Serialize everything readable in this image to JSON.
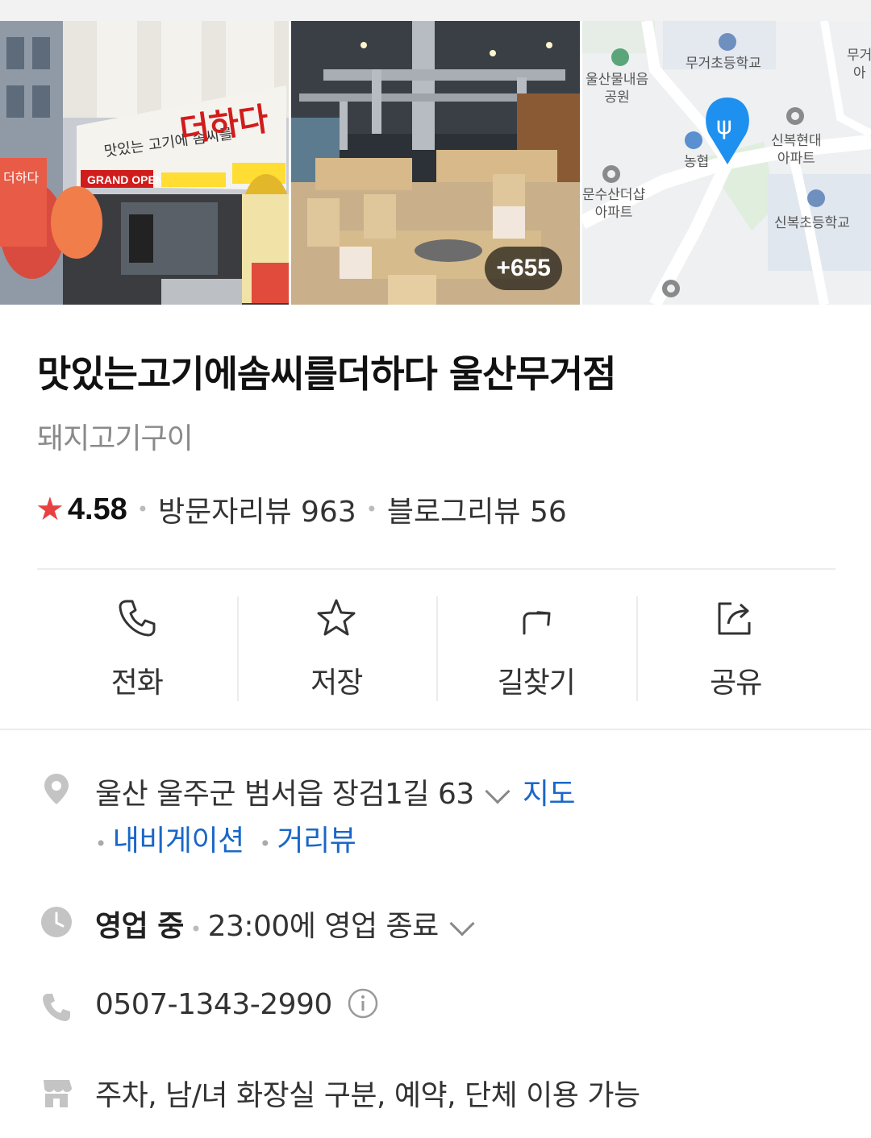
{
  "photos": {
    "more_count": "+655",
    "map_labels": {
      "park": "울산물내음\n공원",
      "school1": "무거초등학교",
      "bank": "농협",
      "apt1": "신복현대\n아파트",
      "apt2": "문수산더샵\n아파트",
      "school2": "신복초등학교",
      "edge": "무거\n아"
    }
  },
  "place": {
    "name": "맛있는고기에솜씨를더하다 울산무거점",
    "category": "돼지고기구이",
    "rating": "4.58",
    "visitor_reviews": "방문자리뷰 963",
    "blog_reviews": "블로그리뷰 56"
  },
  "actions": [
    {
      "label": "전화",
      "icon": "phone-icon"
    },
    {
      "label": "저장",
      "icon": "star-icon"
    },
    {
      "label": "길찾기",
      "icon": "directions-icon"
    },
    {
      "label": "공유",
      "icon": "share-icon"
    }
  ],
  "info": {
    "address": "울산 울주군 범서읍 장검1길 63",
    "map_link": "지도",
    "navigation_link": "내비게이션",
    "streetview_link": "거리뷰",
    "status": "영업 중",
    "hours": "23:00에 영업 종료",
    "phone": "0507-1343-2990",
    "amenities": "주차, 남/녀 화장실 구분, 예약, 단체 이용 가능"
  },
  "colors": {
    "star": "#e84141",
    "link": "#1a67c8",
    "map_pin": "#1e90f0"
  }
}
